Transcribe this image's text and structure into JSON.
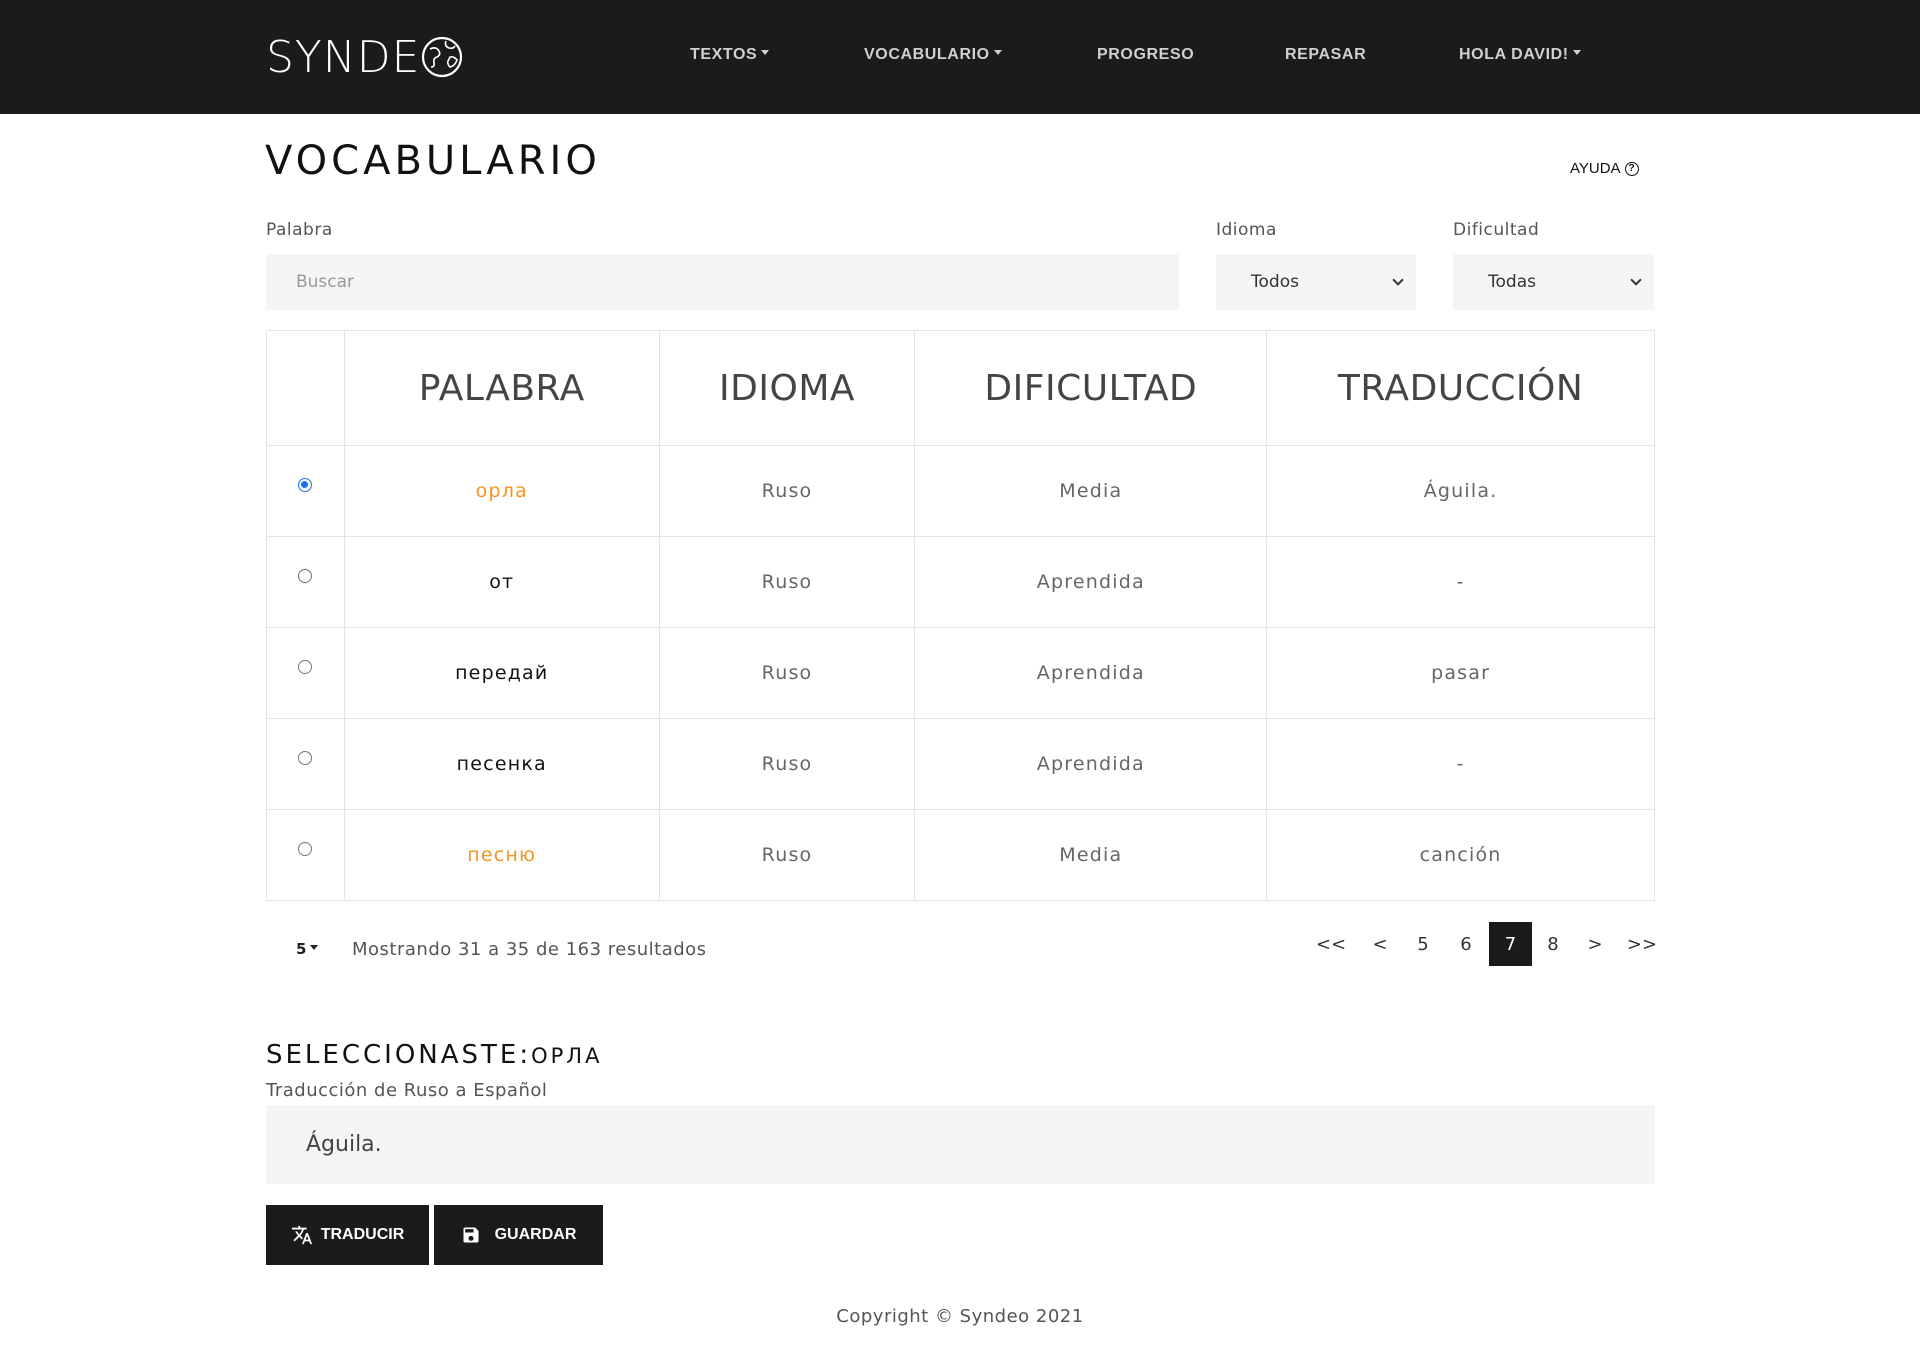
{
  "navbar": {
    "logo": "SYNDE",
    "items": {
      "textos": "TEXTOS",
      "vocabulario": "VOCABULARIO",
      "progreso": "PROGRESO",
      "repasar": "REPASAR",
      "user": "HOLA DAVID!"
    }
  },
  "header": {
    "title": "VOCABULARIO",
    "help": "AYUDA",
    "help_icon": "?"
  },
  "filters": {
    "palabra_label": "Palabra",
    "search_placeholder": "Buscar",
    "idioma_label": "Idioma",
    "idioma_value": "Todos",
    "dificultad_label": "Dificultad",
    "dificultad_value": "Todas"
  },
  "table": {
    "headers": [
      "PALABRA",
      "IDIOMA",
      "DIFICULTAD",
      "TRADUCCIÓN"
    ],
    "rows": [
      {
        "word": "орла",
        "language": "Ruso",
        "difficulty": "Media",
        "translation": "Águila.",
        "selected": true,
        "highlight": true
      },
      {
        "word": "от",
        "language": "Ruso",
        "difficulty": "Aprendida",
        "translation": "-",
        "selected": false,
        "highlight": false
      },
      {
        "word": "передай",
        "language": "Ruso",
        "difficulty": "Aprendida",
        "translation": "pasar",
        "selected": false,
        "highlight": false
      },
      {
        "word": "песенка",
        "language": "Ruso",
        "difficulty": "Aprendida",
        "translation": "-",
        "selected": false,
        "highlight": false
      },
      {
        "word": "песню",
        "language": "Ruso",
        "difficulty": "Media",
        "translation": "canción",
        "selected": false,
        "highlight": true
      }
    ]
  },
  "pagination": {
    "per_page": "5",
    "summary": "Mostrando 31 a 35 de 163 resultados",
    "first": "<<",
    "prev": "<",
    "pages": [
      "5",
      "6",
      "7",
      "8"
    ],
    "active_page": "7",
    "next": ">",
    "last": ">>"
  },
  "selection": {
    "title": "SELECCIONASTE:",
    "word": "ОРЛА",
    "subtitle": "Traducción de Ruso a Español",
    "translation": "Águila."
  },
  "actions": {
    "translate_label": "TRADUCIR",
    "save_label": "GUARDAR"
  },
  "footer": {
    "copyright": "Copyright © Syndeo 2021"
  },
  "colors": {
    "navbar_bg": "#1b1b1b",
    "accent_orange": "#f7941d",
    "radio_blue": "#1a73e8",
    "input_bg": "#f5f5f7"
  }
}
